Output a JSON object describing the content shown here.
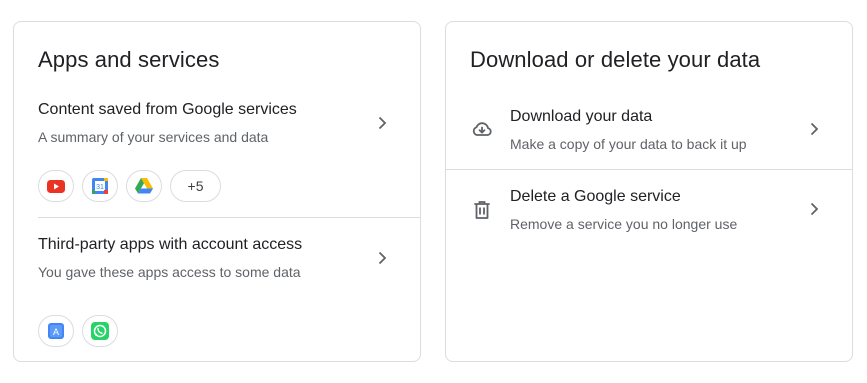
{
  "apps_card": {
    "title": "Apps and services",
    "content_section": {
      "title": "Content saved from Google services",
      "subtitle": "A summary of your services and data",
      "service_icons": [
        "youtube-icon",
        "google-calendar-icon",
        "google-drive-icon"
      ],
      "more_label": "+5"
    },
    "third_party_section": {
      "title": "Third-party apps with account access",
      "subtitle": "You gave these apps access to some data",
      "app_icons": [
        "app-icon-blue-a",
        "whatsapp-icon"
      ]
    }
  },
  "data_card": {
    "title": "Download or delete your data",
    "rows": [
      {
        "icon": "cloud-download-icon",
        "title": "Download your data",
        "subtitle": "Make a copy of your data to back it up"
      },
      {
        "icon": "trash-icon",
        "title": "Delete a Google service",
        "subtitle": "Remove a service you no longer use"
      }
    ]
  },
  "colors": {
    "border": "#dadce0",
    "title_text": "#202124",
    "secondary_text": "#5f6368",
    "youtube_red": "#ea3323",
    "google_blue": "#4285f4",
    "google_green": "#34a853",
    "google_yellow": "#fbbc04",
    "whatsapp_green": "#25d366"
  }
}
